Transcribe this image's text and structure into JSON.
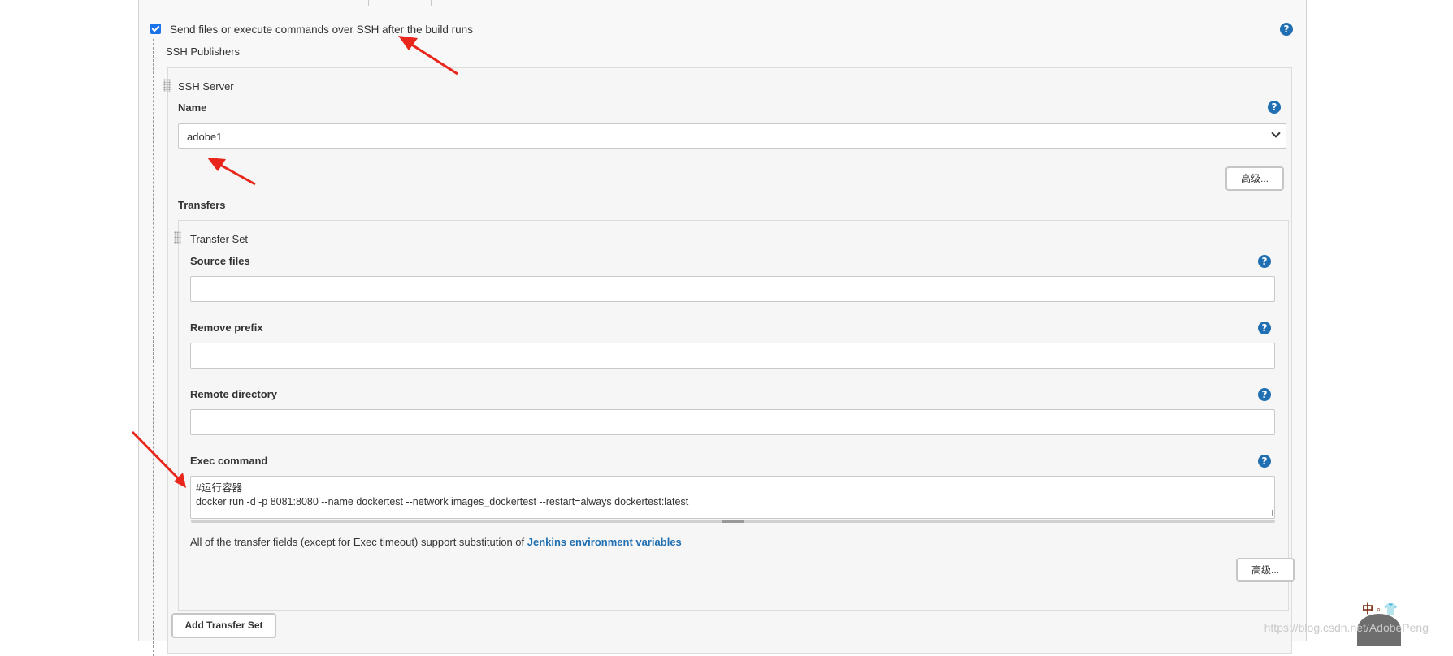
{
  "top_section": {
    "checkbox_label": "Send files or execute commands over SSH after the build runs",
    "section_title": "SSH Publishers"
  },
  "ssh_server": {
    "title": "SSH Server",
    "name_label": "Name",
    "name_value": "adobe1",
    "advanced_button": "高级..."
  },
  "transfers": {
    "title": "Transfers",
    "transfer_set_title": "Transfer Set",
    "source_files_label": "Source files",
    "source_files_value": "",
    "remove_prefix_label": "Remove prefix",
    "remove_prefix_value": "",
    "remote_directory_label": "Remote directory",
    "remote_directory_value": "",
    "exec_command_label": "Exec command",
    "exec_command_value": "#运行容器\ndocker run -d -p 8081:8080 --name dockertest --network images_dockertest --restart=always dockertest:latest",
    "note_text": "All of the transfer fields (except for Exec timeout) support substitution of ",
    "note_link": "Jenkins environment variables",
    "advanced_button": "高级...",
    "add_button": "Add Transfer Set"
  },
  "help_icon_glyph": "?",
  "watermark": "https://blog.csdn.net/AdobePeng",
  "mascot_text": "中 ◦ 👕",
  "colors": {
    "accent_blue": "#1f6fb2",
    "checkbox_blue": "#1a73e8",
    "arrow_red": "#e8261c"
  }
}
